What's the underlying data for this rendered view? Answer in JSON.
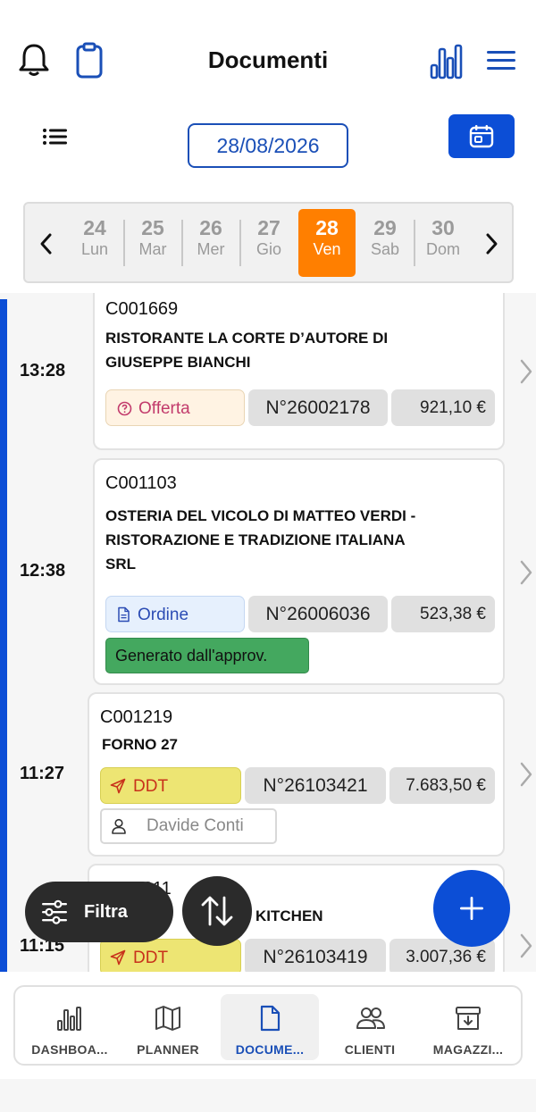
{
  "header": {
    "title": "Documenti",
    "accent_color": "#1a4fb7",
    "left_icons": [
      "bell-icon",
      "clipboard-icon"
    ],
    "right_icons": [
      "bar-chart-icon",
      "hamburger-menu-icon"
    ]
  },
  "toolbar": {
    "date": "28/08/2026",
    "list_icon": "list-icon",
    "calendar_icon": "calendar-icon"
  },
  "week": {
    "days": [
      {
        "num": "24",
        "label": "Lun",
        "selected": false
      },
      {
        "num": "25",
        "label": "Mar",
        "selected": false
      },
      {
        "num": "26",
        "label": "Mer",
        "selected": false
      },
      {
        "num": "27",
        "label": "Gio",
        "selected": false
      },
      {
        "num": "28",
        "label": "Ven",
        "selected": true
      },
      {
        "num": "29",
        "label": "Sab",
        "selected": false
      },
      {
        "num": "30",
        "label": "Dom",
        "selected": false
      }
    ],
    "selected_color": "#ff7f00"
  },
  "documents": [
    {
      "time": "13:28",
      "code": "C001669",
      "name_lines": [
        "RISTORANTE LA CORTE D’AUTORE DI",
        "GIUSEPPE BIANCHI"
      ],
      "type": "Offerta",
      "number": "N°26002178",
      "amount": "921,10 €"
    },
    {
      "time": "12:38",
      "code": "C001103",
      "name_lines": [
        "OSTERIA DEL VICOLO DI MATTEO VERDI -",
        "RISTORAZIONE E TRADIZIONE ITALIANA",
        "SRL"
      ],
      "type": "Ordine",
      "number": "N°26006036",
      "amount": "523,38 €",
      "badge": "Generato dall'approv."
    },
    {
      "time": "11:27",
      "code": "C001219",
      "name_lines": [
        "FORNO 27"
      ],
      "type": "DDT",
      "number": "N°26103421",
      "amount": "7.683,50 €",
      "user": "Davide Conti"
    },
    {
      "time": "11:15",
      "code": "C001211",
      "name_lines": [
        "KITCHEN"
      ],
      "type": "DDT",
      "number": "N°26103419",
      "amount": "3.007,36 €"
    }
  ],
  "actions": {
    "filter_label": "Filtra",
    "sort_icon": "sort-arrows-icon",
    "add_icon": "plus-icon"
  },
  "nav": [
    {
      "label": "DASHBOA...",
      "icon": "dashboard-icon",
      "active": false
    },
    {
      "label": "PLANNER",
      "icon": "map-icon",
      "active": false
    },
    {
      "label": "DOCUME...",
      "icon": "document-icon",
      "active": true
    },
    {
      "label": "CLIENTI",
      "icon": "clients-icon",
      "active": false
    },
    {
      "label": "MAGAZZI...",
      "icon": "warehouse-icon",
      "active": false
    }
  ]
}
